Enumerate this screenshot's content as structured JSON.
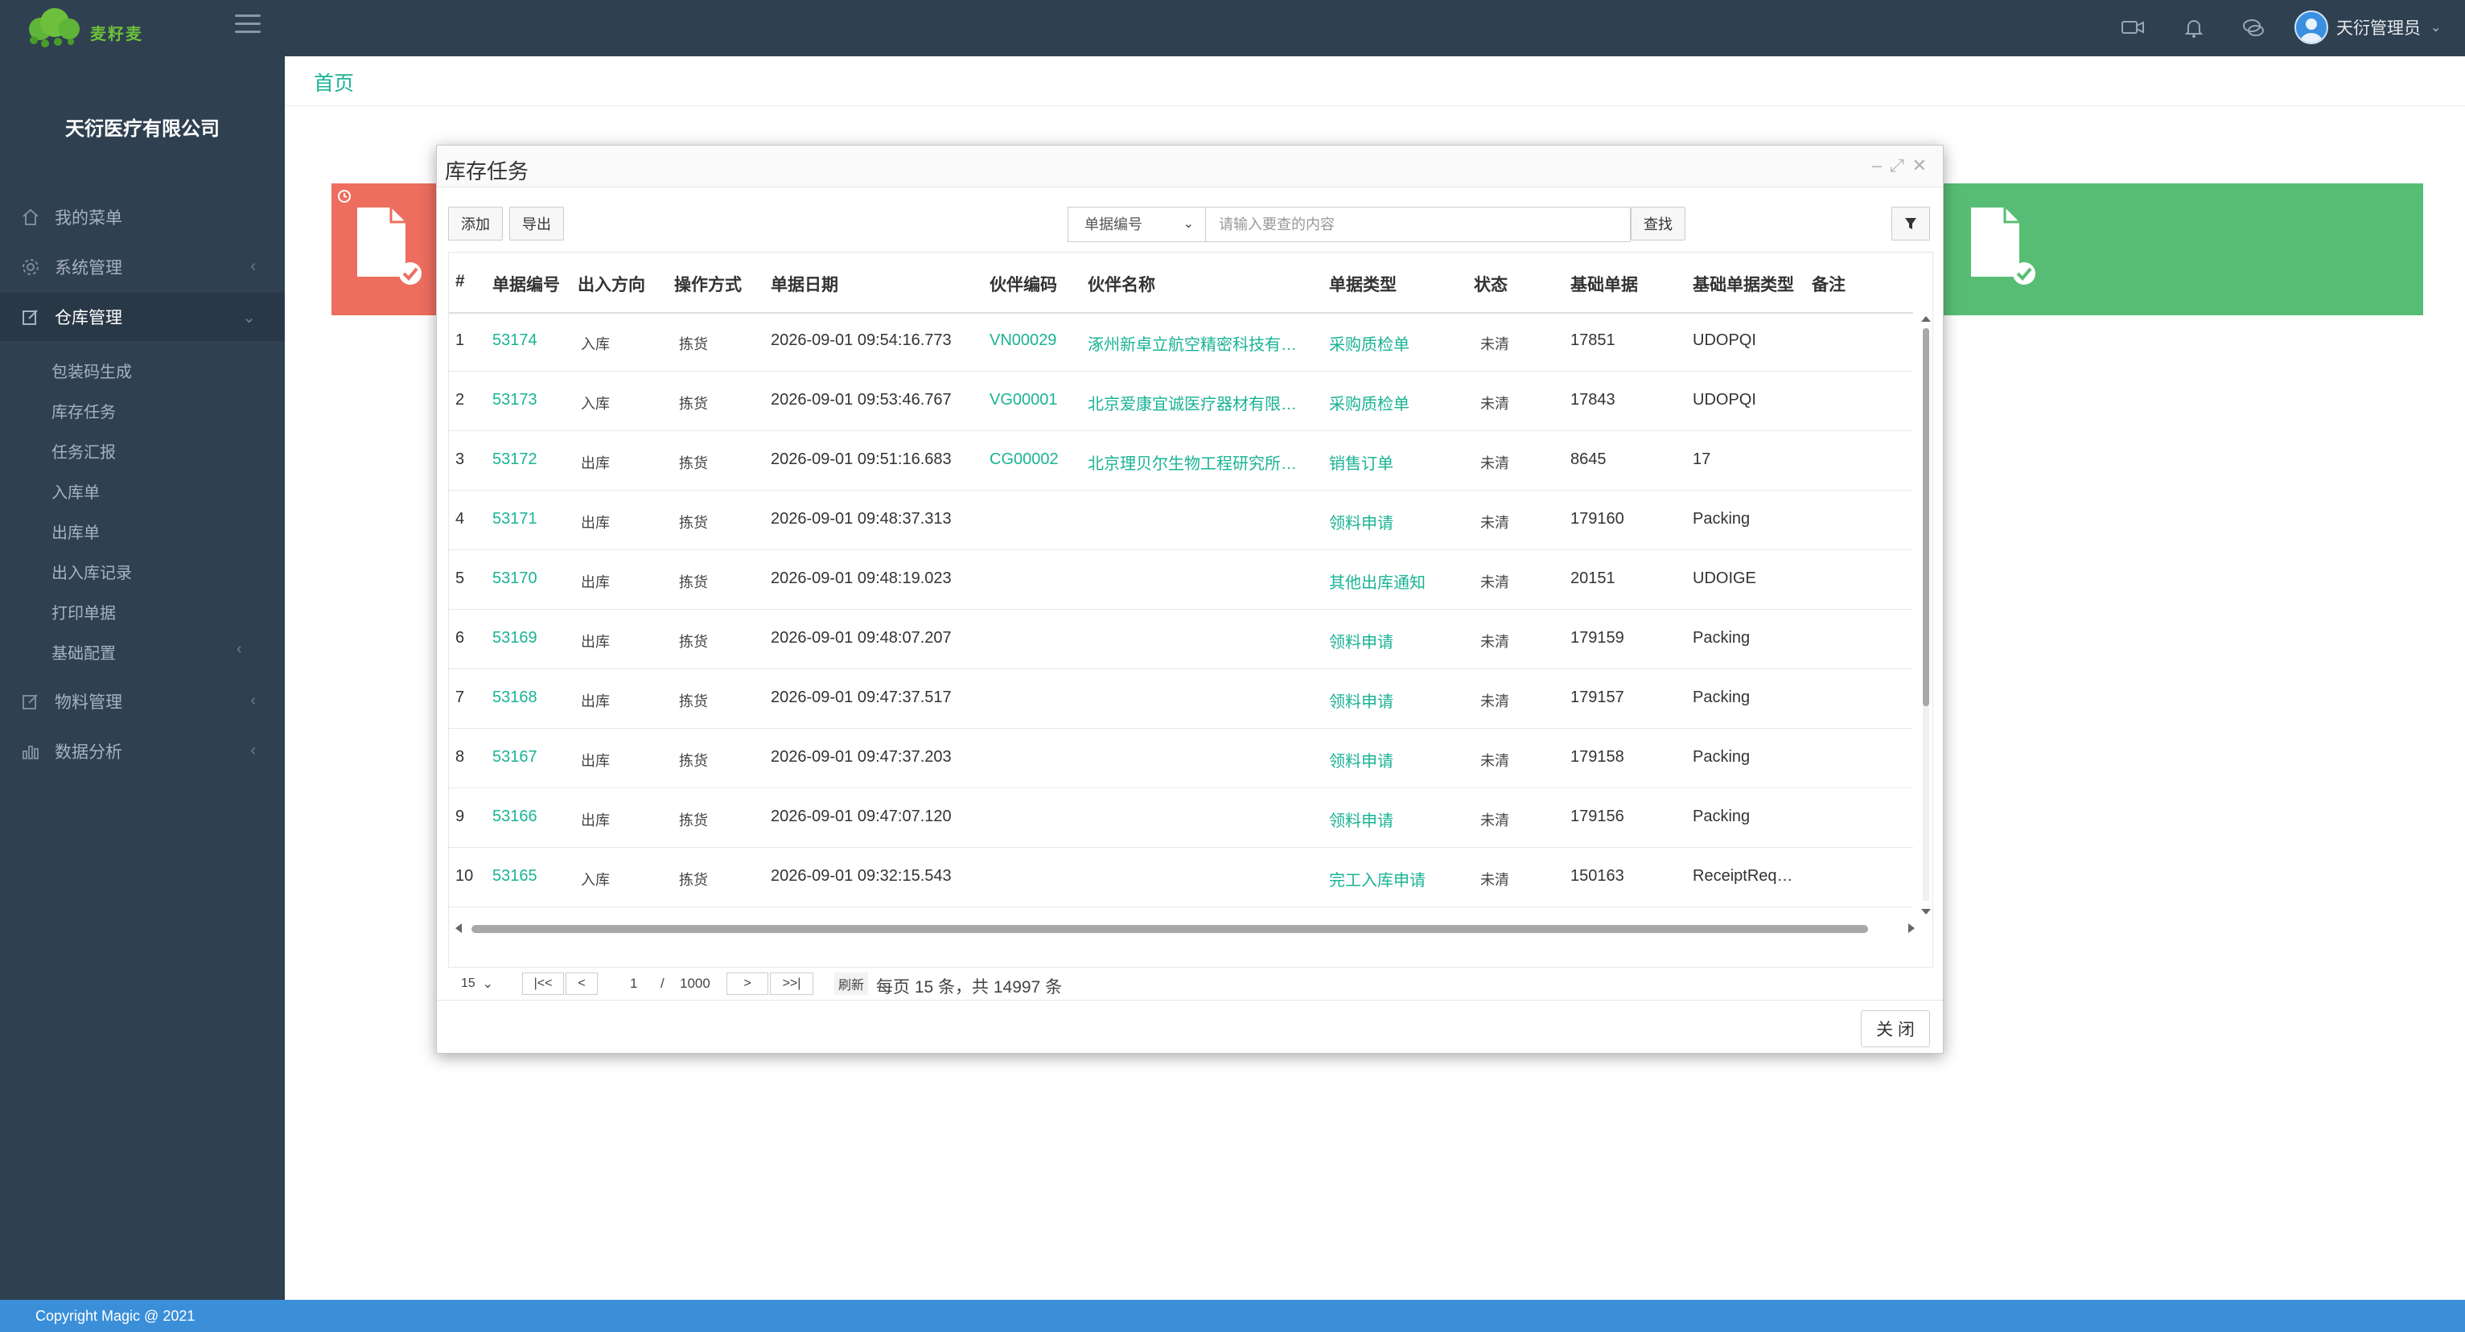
{
  "app": {
    "logo_text": "麦籽麦",
    "company": "天衍医疗有限公司",
    "user_name": "天衍管理员",
    "footer": "Copyright Magic @ 2021"
  },
  "sidebar": {
    "items": [
      {
        "label": "我的菜单",
        "icon": "home-icon"
      },
      {
        "label": "系统管理",
        "icon": "gear-icon"
      },
      {
        "label": "仓库管理",
        "icon": "edit-icon"
      }
    ],
    "subitems": [
      "包装码生成",
      "库存任务",
      "任务汇报",
      "入库单",
      "出库单",
      "出入库记录",
      "打印单据",
      "基础配置"
    ],
    "more_items": [
      {
        "label": "物料管理",
        "icon": "edit-icon"
      },
      {
        "label": "数据分析",
        "icon": "bar-chart-icon"
      }
    ]
  },
  "breadcrumb": "首页",
  "modal": {
    "title": "库存任务",
    "add_label": "添加",
    "export_label": "导出",
    "search_field": "单据编号",
    "search_placeholder": "请输入要查的内容",
    "search_button": "查找",
    "close_label": "关 闭"
  },
  "table": {
    "columns": [
      "#",
      "单据编号",
      "出入方向",
      "操作方式",
      "单据日期",
      "伙伴编码",
      "伙伴名称",
      "单据类型",
      "状态",
      "基础单据",
      "基础单据类型",
      "备注"
    ],
    "rows": [
      {
        "n": "1",
        "code": "53174",
        "dir": "入库",
        "op": "拣货",
        "date": "2026-09-01 09:54:16.773",
        "pcode": "VN00029",
        "pname": "涿州新卓立航空精密科技有…",
        "type": "采购质检单",
        "status": "未清",
        "base": "17851",
        "btype": "UDOPQI"
      },
      {
        "n": "2",
        "code": "53173",
        "dir": "入库",
        "op": "拣货",
        "date": "2026-09-01 09:53:46.767",
        "pcode": "VG00001",
        "pname": "北京爱康宜诚医疗器材有限…",
        "type": "采购质检单",
        "status": "未清",
        "base": "17843",
        "btype": "UDOPQI"
      },
      {
        "n": "3",
        "code": "53172",
        "dir": "出库",
        "op": "拣货",
        "date": "2026-09-01 09:51:16.683",
        "pcode": "CG00002",
        "pname": "北京理贝尔生物工程研究所…",
        "type": "销售订单",
        "status": "未清",
        "base": "8645",
        "btype": "17"
      },
      {
        "n": "4",
        "code": "53171",
        "dir": "出库",
        "op": "拣货",
        "date": "2026-09-01 09:48:37.313",
        "pcode": "",
        "pname": "",
        "type": "领料申请",
        "status": "未清",
        "base": "179160",
        "btype": "Packing"
      },
      {
        "n": "5",
        "code": "53170",
        "dir": "出库",
        "op": "拣货",
        "date": "2026-09-01 09:48:19.023",
        "pcode": "",
        "pname": "",
        "type": "其他出库通知",
        "status": "未清",
        "base": "20151",
        "btype": "UDOIGE"
      },
      {
        "n": "6",
        "code": "53169",
        "dir": "出库",
        "op": "拣货",
        "date": "2026-09-01 09:48:07.207",
        "pcode": "",
        "pname": "",
        "type": "领料申请",
        "status": "未清",
        "base": "179159",
        "btype": "Packing"
      },
      {
        "n": "7",
        "code": "53168",
        "dir": "出库",
        "op": "拣货",
        "date": "2026-09-01 09:47:37.517",
        "pcode": "",
        "pname": "",
        "type": "领料申请",
        "status": "未清",
        "base": "179157",
        "btype": "Packing"
      },
      {
        "n": "8",
        "code": "53167",
        "dir": "出库",
        "op": "拣货",
        "date": "2026-09-01 09:47:37.203",
        "pcode": "",
        "pname": "",
        "type": "领料申请",
        "status": "未清",
        "base": "179158",
        "btype": "Packing"
      },
      {
        "n": "9",
        "code": "53166",
        "dir": "出库",
        "op": "拣货",
        "date": "2026-09-01 09:47:07.120",
        "pcode": "",
        "pname": "",
        "type": "领料申请",
        "status": "未清",
        "base": "179156",
        "btype": "Packing"
      },
      {
        "n": "10",
        "code": "53165",
        "dir": "入库",
        "op": "拣货",
        "date": "2026-09-01 09:32:15.543",
        "pcode": "",
        "pname": "",
        "type": "完工入库申请",
        "status": "未清",
        "base": "150163",
        "btype": "ReceiptReq…"
      }
    ]
  },
  "pager": {
    "page_size": "15",
    "first": "|<<",
    "prev": "<",
    "current": "1",
    "sep": "/",
    "total_pages": "1000",
    "next": ">",
    "last": ">>|",
    "refresh": "刷新",
    "info": "每页 15 条，共 14997 条"
  },
  "colors": {
    "sidebar": "#2f4050",
    "accent": "#1ab394",
    "footer": "#3b8fd9",
    "card_red": "#ed6e5f",
    "card_green": "#58bd74"
  }
}
